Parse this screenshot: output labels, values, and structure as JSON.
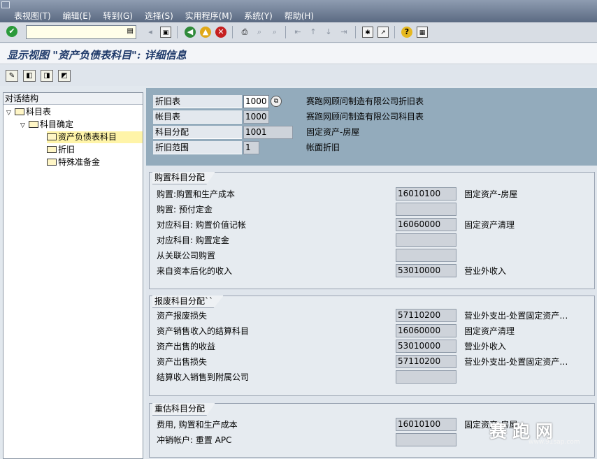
{
  "menu": [
    "表视图(T)",
    "编辑(E)",
    "转到(G)",
    "选择(S)",
    "实用程序(M)",
    "系统(Y)",
    "帮助(H)"
  ],
  "toolbar": {
    "command_value": "",
    "icons": [
      "back-icon",
      "exit-icon",
      "cancel-icon",
      "print-icon",
      "find-icon",
      "find-next-icon",
      "first-page-icon",
      "prev-page-icon",
      "next-page-icon",
      "last-page-icon",
      "new-session-icon",
      "shortcut-icon",
      "help-icon",
      "layout-icon"
    ]
  },
  "title": "显示视图 \"资产负债表科目\": 详细信息",
  "tree": {
    "header": "对话结构",
    "items": [
      {
        "label": "科目表",
        "level": 0
      },
      {
        "label": "科目确定",
        "level": 1
      },
      {
        "label": "资产负债表科目",
        "level": 2
      },
      {
        "label": "折旧",
        "level": 2
      },
      {
        "label": "特殊准备金",
        "level": 2
      }
    ]
  },
  "head": [
    {
      "label": "折旧表",
      "value": "1000",
      "desc": "赛跑网顾问制造有限公司折旧表"
    },
    {
      "label": "帐目表",
      "value": "1000",
      "desc": "赛跑网顾问制造有限公司科目表"
    },
    {
      "label": "科目分配",
      "value": "1001",
      "desc": "固定资产-房屋"
    },
    {
      "label": "折旧范围",
      "value": "1",
      "desc": "帐面折旧"
    }
  ],
  "groups": [
    {
      "title": "购置科目分配",
      "rows": [
        {
          "label": "购置:购置和生产成本",
          "value": "16010100",
          "desc": "固定资产-房屋"
        },
        {
          "label": "购置: 预付定金",
          "value": "",
          "desc": ""
        },
        {
          "label": "对应科目: 购置价值记帐",
          "value": "16060000",
          "desc": "固定资产清理"
        },
        {
          "label": "对应科目: 购置定金",
          "value": "",
          "desc": ""
        },
        {
          "label": "从关联公司购置",
          "value": "",
          "desc": ""
        },
        {
          "label": "来自资本后化的收入",
          "value": "53010000",
          "desc": "营业外收入"
        }
      ]
    },
    {
      "title": "报废科目分配``",
      "rows": [
        {
          "label": "资产报废损失",
          "value": "57110200",
          "desc": "营业外支出-处置固定资产净损失"
        },
        {
          "label": "资产销售收入的结算科目",
          "value": "16060000",
          "desc": "固定资产清理"
        },
        {
          "label": "资产出售的收益",
          "value": "53010000",
          "desc": "营业外收入"
        },
        {
          "label": "资产出售损失",
          "value": "57110200",
          "desc": "营业外支出-处置固定资产净损失"
        },
        {
          "label": "结算收入销售到附属公司",
          "value": "",
          "desc": ""
        }
      ]
    },
    {
      "title": "重估科目分配",
      "rows": [
        {
          "label": "费用, 购置和生产成本",
          "value": "16010100",
          "desc": "固定资产-房屋"
        },
        {
          "label": "冲销帐户: 重置 APC",
          "value": "",
          "desc": ""
        }
      ]
    }
  ],
  "watermark": {
    "text": "赛跑网",
    "url": "www.91sap.com"
  },
  "colors": {
    "title": "#1f3a6a",
    "head_bg": "#93abbc",
    "selected": "#fff4a8"
  }
}
